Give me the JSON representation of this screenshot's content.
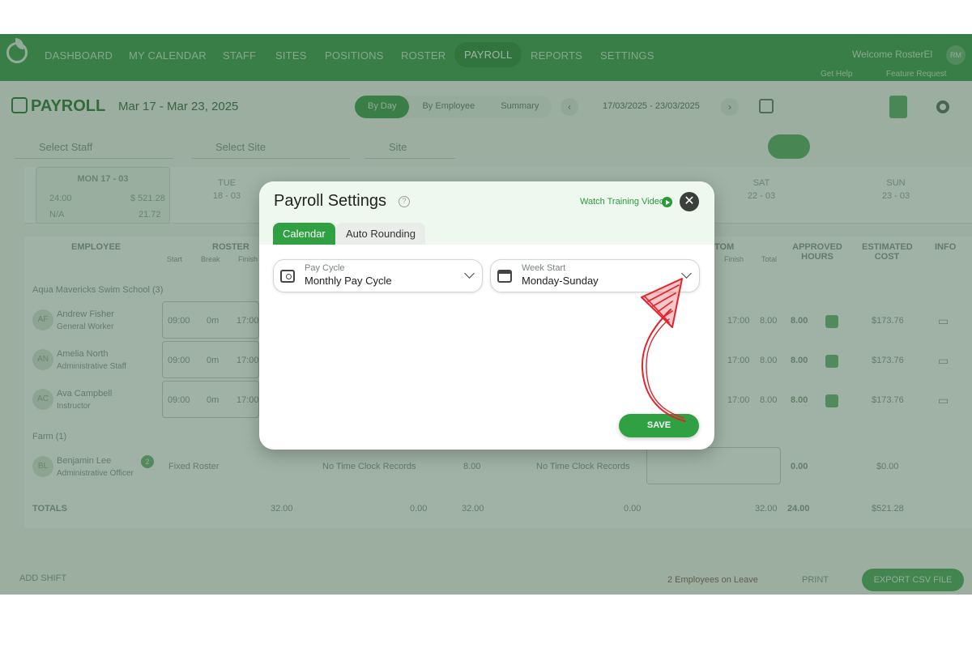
{
  "nav": {
    "items": [
      "DASHBOARD",
      "MY CALENDAR",
      "STAFF",
      "SITES",
      "POSITIONS",
      "ROSTER",
      "PAYROLL",
      "REPORTS",
      "SETTINGS"
    ],
    "active": "PAYROLL",
    "welcome": "Welcome RosterEl",
    "avatar": "RM",
    "get_help": "Get Help",
    "feature_request": "Feature Request"
  },
  "header": {
    "title": "PAYROLL",
    "date_range": "Mar 17 - Mar 23, 2025",
    "view_modes": [
      "By Day",
      "By Employee",
      "Summary"
    ],
    "active_view": "By Day",
    "dates": "17/03/2025 - 23/03/2025"
  },
  "filters": {
    "staff_placeholder": "Select Staff",
    "site_placeholder": "Select Site",
    "group": "Site"
  },
  "days": {
    "active_label": "MON 17 - 03",
    "hours": "24:00",
    "cost": "$ 521.28",
    "na": "N/A",
    "ratio": "21.72",
    "others": [
      {
        "label": "TUE",
        "date": "18 - 03"
      },
      {
        "label": "SAT",
        "date": "22 - 03"
      },
      {
        "label": "SUN",
        "date": "23 - 03"
      }
    ]
  },
  "table": {
    "headers": {
      "employee": "EMPLOYEE",
      "roster": "ROSTER",
      "roster_sub": [
        "Start",
        "Break",
        "Finish"
      ],
      "custom": "TOM",
      "custom_sub": [
        "Finish",
        "Total"
      ],
      "approved": "APPROVED HOURS",
      "estimated": "ESTIMATED COST",
      "info": "INFO"
    },
    "group1": "Aqua Mavericks Swim School",
    "group1_count": "(3)",
    "rows": [
      {
        "initials": "AF",
        "name": "Andrew Fisher",
        "role": "General Worker",
        "start": "09:00",
        "brk": "0m",
        "finish": "17:00",
        "c_finish": "17:00",
        "c_total": "8.00",
        "approved": "8.00",
        "cost": "$173.76"
      },
      {
        "initials": "AN",
        "name": "Amelia North",
        "role": "Administrative Staff",
        "start": "09:00",
        "brk": "0m",
        "finish": "17:00",
        "c_finish": "17:00",
        "c_total": "8.00",
        "approved": "8.00",
        "cost": "$173.76"
      },
      {
        "initials": "AC",
        "name": "Ava Campbell",
        "role": "Instructor",
        "start": "09:00",
        "brk": "0m",
        "finish": "17:00",
        "c_finish": "17:00",
        "c_total": "8.00",
        "approved": "8.00",
        "cost": "$173.76"
      }
    ],
    "group2": "Farm",
    "group2_count": "(1)",
    "row4": {
      "initials": "BL",
      "name": "Benjamin Lee",
      "role": "Administrative Officer",
      "badge": "2",
      "roster": "Fixed Roster",
      "clock1": "No Time Clock Records",
      "hrs": "8.00",
      "clock2": "No Time Clock Records",
      "approved": "0.00",
      "cost": "$0.00"
    },
    "totals": {
      "label": "TOTALS",
      "rostered": "32.00",
      "t2": "0.00",
      "t3": "32.00",
      "t4": "0.00",
      "t5": "32.00",
      "approved": "24.00",
      "cost": "$521.28"
    }
  },
  "footer": {
    "add_shift": "ADD SHIFT",
    "leave": "2 Employees on Leave",
    "print": "PRINT",
    "export": "EXPORT CSV FILE"
  },
  "modal": {
    "title": "Payroll Settings",
    "help": "?",
    "watch_video": "Watch Training Video",
    "close": "✕",
    "tabs": [
      "Calendar",
      "Auto Rounding"
    ],
    "active_tab": "Calendar",
    "pay_cycle": {
      "label": "Pay Cycle",
      "value": "Monthly Pay Cycle"
    },
    "week_start": {
      "label": "Week Start",
      "value": "Monday-Sunday"
    },
    "save": "SAVE"
  },
  "colors": {
    "brand_green": "#2fa142",
    "annotation_red": "#e5212a"
  }
}
